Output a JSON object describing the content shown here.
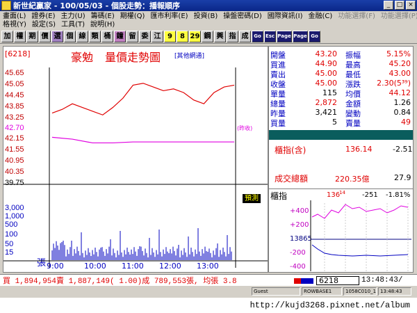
{
  "window": {
    "title": "新世紀贏家 - 100/05/03 - 個股走勢：播報順序"
  },
  "menu": {
    "row1": [
      "畫面(L)",
      "證券(E)",
      "主力(U)",
      "籌碼(E)",
      "期權(Q)",
      "匯市利率(E)",
      "投資(B)",
      "操盤密碼(D)",
      "國際資訊(I)",
      "金融(C)",
      "功能選擇(F)",
      "功能選擇(P)"
    ],
    "row2": [
      "格視(Y)",
      "設定(S)",
      "工具(T)",
      "說明(H)"
    ]
  },
  "toolbar": {
    "buttons": [
      "加",
      "權",
      "期",
      "價",
      "選",
      "個",
      "線",
      "類",
      "桶",
      "鐘",
      "留",
      "委",
      "江",
      "9",
      "8",
      "29",
      "鋼",
      "興",
      "指",
      "成",
      "Go",
      "Esc",
      "Page Up",
      "Page Dn",
      "Go"
    ]
  },
  "chart": {
    "ticker": "[6218]",
    "stock_name": "豪勉",
    "title": "量價走勢圖",
    "subtitle": "[其他網通]",
    "ref_note": "(昨收)",
    "badge": "預測",
    "y_labels_red": [
      "45.65",
      "45.05",
      "44.45",
      "43.85",
      "43.25"
    ],
    "y_ref": "42.70",
    "y_labels_green": [
      "42.15",
      "41.55",
      "40.95",
      "40.35"
    ],
    "y_floor": "39.75",
    "vol_labels": [
      "3,000",
      "1,000",
      "500",
      "100",
      "50",
      "15"
    ],
    "vol_unit": "張",
    "x_labels": [
      "9:00",
      "10:00",
      "11:00",
      "12:00",
      "13:00"
    ]
  },
  "chart_data": [
    {
      "type": "line",
      "title": "量價走勢圖",
      "series": [
        {
          "name": "價",
          "x": [
            "9:00",
            "9:15",
            "9:30",
            "9:45",
            "10:00",
            "10:15",
            "10:30",
            "10:45",
            "11:00",
            "11:15",
            "11:30",
            "11:45",
            "12:00",
            "12:15",
            "12:30",
            "12:45",
            "13:00",
            "13:15",
            "13:30"
          ],
          "values": [
            43.5,
            43.7,
            44.0,
            43.8,
            43.6,
            43.4,
            43.8,
            44.3,
            45.0,
            45.1,
            44.9,
            44.7,
            44.8,
            44.6,
            44.2,
            44.0,
            44.6,
            44.9,
            45.0
          ]
        },
        {
          "name": "均",
          "x": [
            "9:00",
            "9:30",
            "10:00",
            "10:30",
            "11:00",
            "11:30",
            "12:00",
            "12:30",
            "13:00",
            "13:30"
          ],
          "values": [
            42.2,
            42.1,
            41.9,
            41.9,
            41.95,
            41.95,
            41.95,
            41.95,
            41.95,
            41.95
          ]
        }
      ],
      "ylim": [
        39.75,
        45.65
      ]
    }
  ],
  "quote": {
    "rows": [
      {
        "l1": "開盤",
        "v1": "43.20",
        "l2": "振幅",
        "v2": "5.15%"
      },
      {
        "l1": "買進",
        "v1": "44.90",
        "l2": "最高",
        "v2": "45.20"
      },
      {
        "l1": "賣出",
        "v1": "45.00",
        "l2": "最低",
        "v2": "43.00"
      },
      {
        "l1": "收盤",
        "v1": "45.00",
        "l2": "漲跌",
        "v2": "2.30(5³⁹)"
      },
      {
        "l1": "單量",
        "v1": "115",
        "l2": "均價",
        "v2": "44.12"
      },
      {
        "l1": "總量",
        "v1": "2,872",
        "l2": "金額",
        "v2": "1.26"
      },
      {
        "l1": "昨量",
        "v1": "3,421",
        "l2": "變動",
        "v2": "0.84"
      },
      {
        "l1": "買量",
        "v1": "5",
        "l2": "賣量",
        "v2": "49"
      }
    ],
    "index_label": "櫃指(含)",
    "index_value": "136.14",
    "index_change": "-2.51",
    "turnover_label": "成交總額",
    "turnover_value": "220.35億",
    "turnover_change": "27.9"
  },
  "mini": {
    "label": "櫃指",
    "value": "136",
    "value_small": "14",
    "change": "-251",
    "pct": "-1.81%",
    "ylabels": [
      "+400",
      "+200",
      "13865",
      "-200",
      "-400"
    ]
  },
  "bottom": {
    "summary": "買 1,894,954賣 1,887,149( 1.00)成 789,553張, 均張 3.8",
    "code": "6218",
    "time": "13:48:43/"
  },
  "status": [
    "Guest",
    "ROWBASE1",
    "1058C010_1",
    "13:48:43"
  ],
  "footer": "http://kujd3268.pixnet.net/album"
}
